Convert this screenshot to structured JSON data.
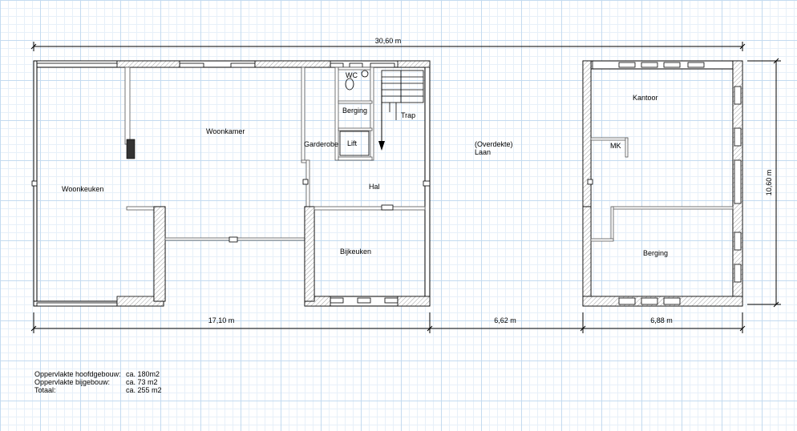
{
  "rooms": {
    "woonkeuken": "Woonkeuken",
    "woonkamer": "Woonkamer",
    "wc": "WC",
    "berging_small": "Berging",
    "trap": "Trap",
    "garderobe": "Garderobe",
    "lift": "Lift",
    "hal": "Hal",
    "bijkeuken": "Bijkeuken",
    "laan_line1": "(Overdekte)",
    "laan_line2": "Laan",
    "kantoor": "Kantoor",
    "mk": "MK",
    "berging_large": "Berging"
  },
  "dimensions": {
    "total_width": "30,60 m",
    "height": "10,60 m",
    "main_width": "17,10 m",
    "laan_width": "6,62 m",
    "annex_width": "6,88 m"
  },
  "areas": [
    {
      "label": "Oppervlakte hoofdgebouw:",
      "value": "ca. 180m2"
    },
    {
      "label": "Oppervlakte bijgebouw:",
      "value": "ca. 73 m2"
    },
    {
      "label": "Totaal:",
      "value": "ca. 255 m2"
    }
  ]
}
